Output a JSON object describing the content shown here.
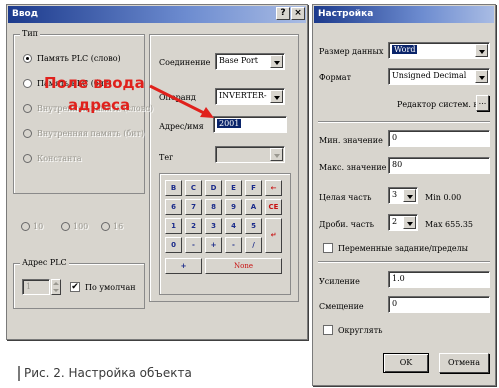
{
  "input_dialog": {
    "title": "Ввод",
    "help_btn": "?",
    "close_btn": "×",
    "type_group": {
      "title": "Тип",
      "options": [
        {
          "label": "Память PLC (слово)",
          "selected": true,
          "disabled": false
        },
        {
          "label": "Память PLC (бит)",
          "selected": false,
          "disabled": false
        },
        {
          "label": "Внутренняя память (слово)",
          "selected": false,
          "disabled": true
        },
        {
          "label": "Внутренняя память (бит)",
          "selected": false,
          "disabled": true
        },
        {
          "label": "Константа",
          "selected": false,
          "disabled": true
        }
      ]
    },
    "radix": [
      {
        "label": "10",
        "disabled": true
      },
      {
        "label": "100",
        "disabled": true
      },
      {
        "label": "16",
        "disabled": true
      }
    ],
    "plc_address": {
      "title": "Адрес PLC",
      "value": "1",
      "auto_increment_label": "По умолчан",
      "auto_increment_checked": true,
      "check_mark": "✔"
    },
    "connection_label": "Соединение",
    "connection_value": "Base Port",
    "operand_label": "Операнд",
    "operand_value": "INVERTER-",
    "address_label": "Адрес/имя",
    "address_value": "2001",
    "tag_label": "Тег",
    "tag_value": "",
    "keypad": {
      "rows": [
        [
          "B",
          "C",
          "D",
          "E",
          "F",
          "←"
        ],
        [
          "6",
          "7",
          "8",
          "9",
          "A",
          "CE"
        ],
        [
          "1",
          "2",
          "3",
          "4",
          "5",
          ""
        ],
        [
          "0",
          "-",
          "+",
          "-",
          "/",
          ""
        ]
      ],
      "enter_glyph": "↵",
      "bottom_left": "+",
      "none_label": "None"
    }
  },
  "settings_dialog": {
    "title": "Настройка",
    "size_label": "Размер данных",
    "size_value": "Word",
    "format_label": "Формат",
    "format_value": "Unsigned Decimal",
    "editor_label": "Редактор систем. к",
    "editor_btn": "...",
    "min_label": "Мин. значение",
    "min_value": "0",
    "max_label": "Макс. значение",
    "max_value": "80",
    "int_label": "Целая часть",
    "int_value": "3",
    "int_min": "Min  0.00",
    "frac_label": "Дроби. часть",
    "frac_value": "2",
    "frac_max": "Max  655.35",
    "variable_limits_label": "Переменные задание/пределы",
    "gain_label": "Усиление",
    "gain_value": "1.0",
    "offset_label": "Смещение",
    "offset_value": "0",
    "round_label": "Округлять",
    "ok_label": "OK",
    "cancel_label": "Отмена"
  },
  "annotation": {
    "line1": "Поле ввода",
    "line2": "адреса",
    "color": "#e0211c"
  },
  "caption": "Рис. 2. Настройка объекта"
}
